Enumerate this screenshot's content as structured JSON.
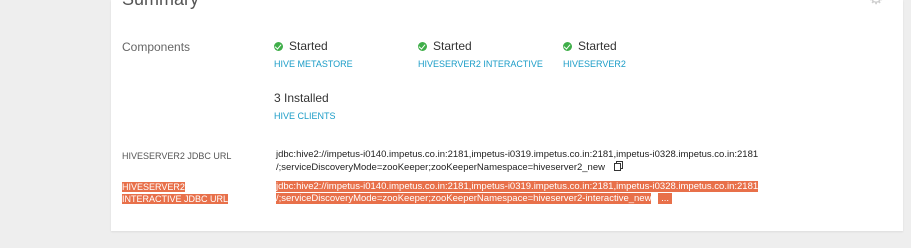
{
  "summary": {
    "title": "Summary",
    "settings_icon": "gear-icon"
  },
  "components": {
    "label": "Components",
    "items": [
      {
        "status": "Started",
        "name": "HIVE METASTORE"
      },
      {
        "status": "Started",
        "name": "HIVESERVER2 INTERACTIVE"
      },
      {
        "status": "Started",
        "name": "HIVESERVER2"
      }
    ],
    "clients": {
      "status": "3 Installed",
      "name": "HIVE CLIENTS"
    }
  },
  "jdbc": {
    "hs2_label": "HIVESERVER2 JDBC URL",
    "hs2_line1": "jdbc:hive2://impetus-i0140.impetus.co.in:2181,impetus-i0319.impetus.co.in:2181,impetus-i0328.impetus.co.in:2181",
    "hs2_line2": "/;serviceDiscoveryMode=zooKeeper;zooKeeperNamespace=hiveserver2_new",
    "hsi_label_line1": "HIVESERVER2",
    "hsi_label_line2": "INTERACTIVE JDBC URL",
    "hsi_line1": "jdbc:hive2://impetus-i0140.impetus.co.in:2181,impetus-i0319.impetus.co.in:2181,impetus-i0328.impetus.co.in:2181",
    "hsi_line2": "/;serviceDiscoveryMode=zooKeeper;zooKeeperNamespace=hiveserver2-interactive_new",
    "more": "..."
  },
  "colors": {
    "started": "#3fae49",
    "link": "#1a9cc7",
    "highlight": "#e8704a"
  }
}
